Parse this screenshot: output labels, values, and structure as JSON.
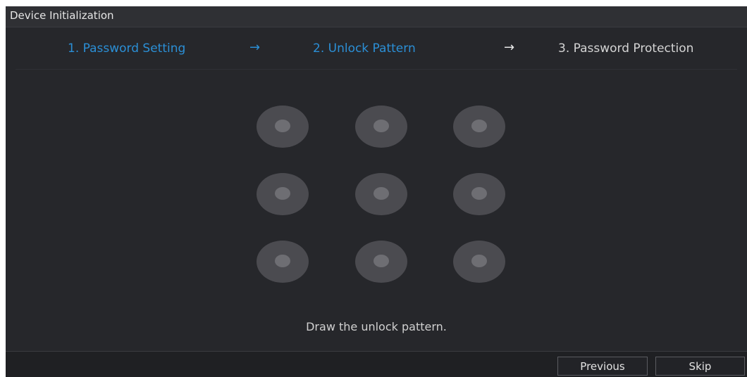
{
  "window": {
    "title": "Device Initialization"
  },
  "steps": [
    {
      "label": "1.  Password Setting",
      "state": "active"
    },
    {
      "label": "2.  Unlock Pattern",
      "state": "active"
    },
    {
      "label": "3.  Password Protection",
      "state": "inactive"
    }
  ],
  "arrows": [
    "→",
    "→"
  ],
  "pattern": {
    "rows": 3,
    "cols": 3,
    "hint": "Draw the unlock pattern."
  },
  "footer": {
    "previous_label": "Previous",
    "skip_label": "Skip"
  },
  "colors": {
    "accent": "#2b8fd6",
    "background": "#26272b",
    "node": "#4b4b50",
    "node_center": "#6e6e73"
  }
}
